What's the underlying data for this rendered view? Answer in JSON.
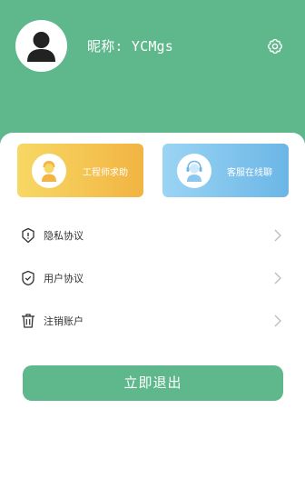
{
  "profile": {
    "nickname": "昵称: YCMgs",
    "avatar_icon": "user-avatar-icon",
    "settings_icon": "gear-icon"
  },
  "cards": {
    "help_label": "工程师求助",
    "service_label": "客服在线聊"
  },
  "menu": [
    {
      "label": "隐私协议",
      "icon": "shield-alert-icon"
    },
    {
      "label": "用户协议",
      "icon": "shield-check-icon"
    },
    {
      "label": "注销账户",
      "icon": "trash-icon"
    }
  ],
  "logout_label": "立即退出",
  "colors": {
    "primary": "#5eb88c",
    "help_card_start": "#f7d865",
    "help_card_end": "#f2b442",
    "service_card_start": "#9bd4f4",
    "service_card_end": "#6bb6e6"
  }
}
